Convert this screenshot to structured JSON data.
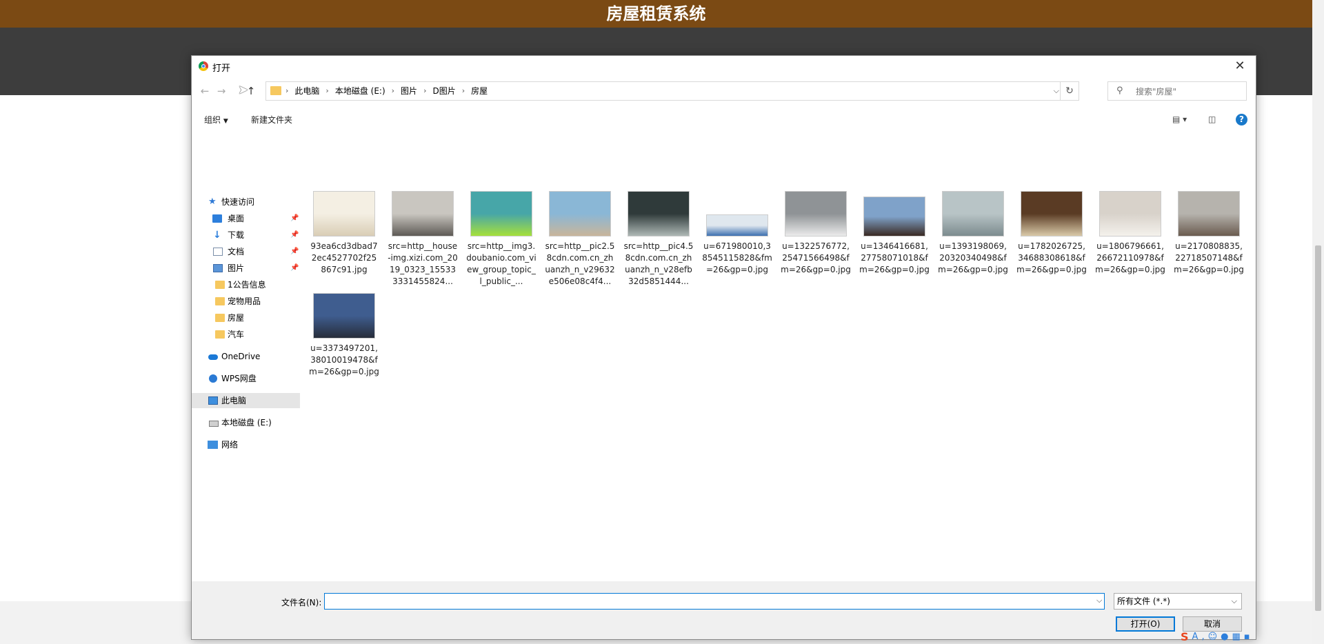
{
  "app": {
    "title": "房屋租赁系统"
  },
  "dialog": {
    "title": "打开",
    "breadcrumbs": [
      "此电脑",
      "本地磁盘 (E:)",
      "图片",
      "D图片",
      "房屋"
    ],
    "search_placeholder": "搜索\"房屋\"",
    "toolbar": {
      "organize": "组织",
      "new_folder": "新建文件夹"
    },
    "sidebar": [
      {
        "label": "快速访问",
        "icon": "star-icon"
      },
      {
        "label": "桌面",
        "icon": "desktop-icon",
        "pinned": true
      },
      {
        "label": "下载",
        "icon": "download-icon",
        "pinned": true
      },
      {
        "label": "文档",
        "icon": "document-icon",
        "pinned": true
      },
      {
        "label": "图片",
        "icon": "pictures-icon",
        "pinned": true
      },
      {
        "label": "1公告信息",
        "icon": "folder-icon"
      },
      {
        "label": "宠物用品",
        "icon": "folder-icon"
      },
      {
        "label": "房屋",
        "icon": "folder-icon"
      },
      {
        "label": "汽车",
        "icon": "folder-icon"
      },
      {
        "label": "OneDrive",
        "icon": "onedrive-icon"
      },
      {
        "label": "WPS网盘",
        "icon": "wps-cloud-icon"
      },
      {
        "label": "此电脑",
        "icon": "this-pc-icon",
        "selected": true
      },
      {
        "label": "本地磁盘 (E:)",
        "icon": "drive-icon"
      },
      {
        "label": "网络",
        "icon": "network-icon"
      }
    ],
    "files": [
      {
        "name": "93ea6cd3dbad72ec4527702f25867c91.jpg",
        "colors": [
          "#f4efe3",
          "#d9cdb5"
        ]
      },
      {
        "name": "src=http__house-img.xizi.com_2019_0323_155333331455824...",
        "colors": [
          "#c9c6c0",
          "#5e5a55"
        ]
      },
      {
        "name": "src=http__img3.doubanio.com_view_group_topic_l_public_...",
        "colors": [
          "#47a6a8",
          "#a6e03a"
        ]
      },
      {
        "name": "src=http__pic2.58cdn.com.cn_zhuanzh_n_v29632e506e08c4f4...",
        "colors": [
          "#8ab7d6",
          "#c9b59a"
        ]
      },
      {
        "name": "src=http__pic4.58cdn.com.cn_zhuanzh_n_v28efb32d5851444...",
        "colors": [
          "#2f3a3a",
          "#aeb8b5"
        ]
      },
      {
        "name": "u=671980010,38545115828&fm=26&gp=0.jpg",
        "colors": [
          "#dfe7ee",
          "#3c6fb0"
        ]
      },
      {
        "name": "u=1322576772,25471566498&fm=26&gp=0.jpg",
        "colors": [
          "#8f9396",
          "#ebebeb"
        ]
      },
      {
        "name": "u=1346416681,27758071018&fm=26&gp=0.jpg",
        "colors": [
          "#7fa2c9",
          "#3a2a23"
        ]
      },
      {
        "name": "u=1393198069,20320340498&fm=26&gp=0.jpg",
        "colors": [
          "#b8c4c6",
          "#7c8b8e"
        ]
      },
      {
        "name": "u=1782026725,34688308618&fm=26&gp=0.jpg",
        "colors": [
          "#5a3b24",
          "#d9c9a8"
        ]
      },
      {
        "name": "u=1806796661,26672110978&fm=26&gp=0.jpg",
        "colors": [
          "#d8d2ca",
          "#f4f1ec"
        ]
      },
      {
        "name": "u=2170808835,22718507148&fm=26&gp=0.jpg",
        "colors": [
          "#b6b3ad",
          "#6a5b4f"
        ]
      },
      {
        "name": "u=3373497201,38010019478&fm=26&gp=0.jpg",
        "colors": [
          "#3f5d8f",
          "#272d3a"
        ]
      }
    ],
    "footer": {
      "filename_label": "文件名(N):",
      "filename_value": "",
      "filetype": "所有文件 (*.*)",
      "open_button": "打开(O)",
      "cancel_button": "取消"
    }
  }
}
